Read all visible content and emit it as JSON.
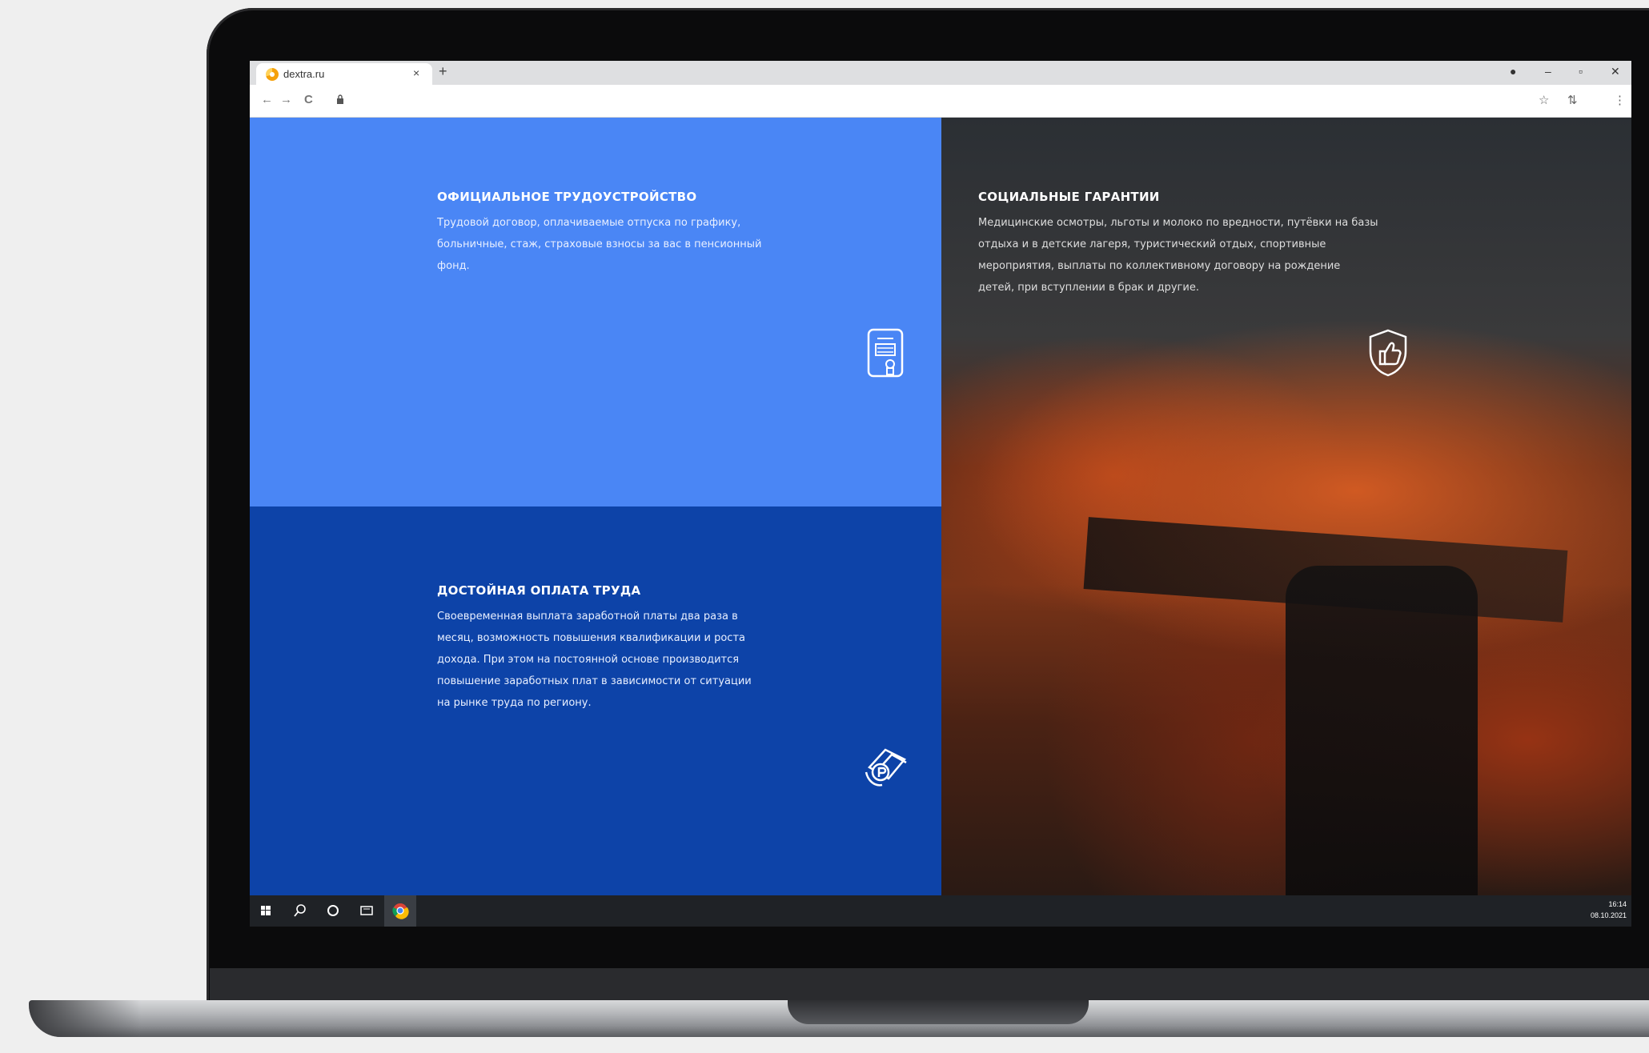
{
  "browser": {
    "tab_title": "dextra.ru",
    "tab_close": "×",
    "new_tab": "+",
    "window_controls": {
      "profile": "●",
      "minimize": "–",
      "maximize": "▫",
      "close": "✕"
    },
    "nav": {
      "back": "←",
      "forward": "→",
      "reload": "C"
    },
    "right_tools": {
      "star": "☆",
      "extension": "⇅",
      "menu": "⋮"
    }
  },
  "sections": {
    "official": {
      "title": "ОФИЦИАЛЬНОЕ ТРУДОУСТРОЙСТВО",
      "text": "Трудовой договор, оплачиваемые отпуска по графику, больничные, стаж, страховые взносы за вас в пенсионный фонд.",
      "icon": "contract-document-icon"
    },
    "pay": {
      "title": "ДОСТОЙНАЯ ОПЛАТА ТРУДА",
      "text": "Своевременная выплата заработной платы два раза в месяц, возможность повышения квалификации и роста дохода. При этом на постоянной основе производится повышение заработных плат в зависимости от ситуации на рынке труда по региону.",
      "icon": "money-hand-icon"
    },
    "social": {
      "title": "СОЦИАЛЬНЫЕ ГАРАНТИИ",
      "text": "Медицинские осмотры, льготы и молоко по вредности, путёвки на базы отдыха и в детские лагеря, туристический отдых, спортивные мероприятия, выплаты по коллективному договору на рождение детей, при вступлении в брак и другие.",
      "icon": "shield-thumbs-up-icon"
    }
  },
  "colors": {
    "official_bg": "#4a86f5",
    "pay_bg": "#0d43a8",
    "taskbar_bg": "#1f2226"
  },
  "taskbar": {
    "time": "16:14",
    "date": "08.10.2021",
    "icons": [
      "windows-start-icon",
      "search-icon",
      "cortana-icon",
      "task-view-icon",
      "chrome-icon"
    ]
  }
}
